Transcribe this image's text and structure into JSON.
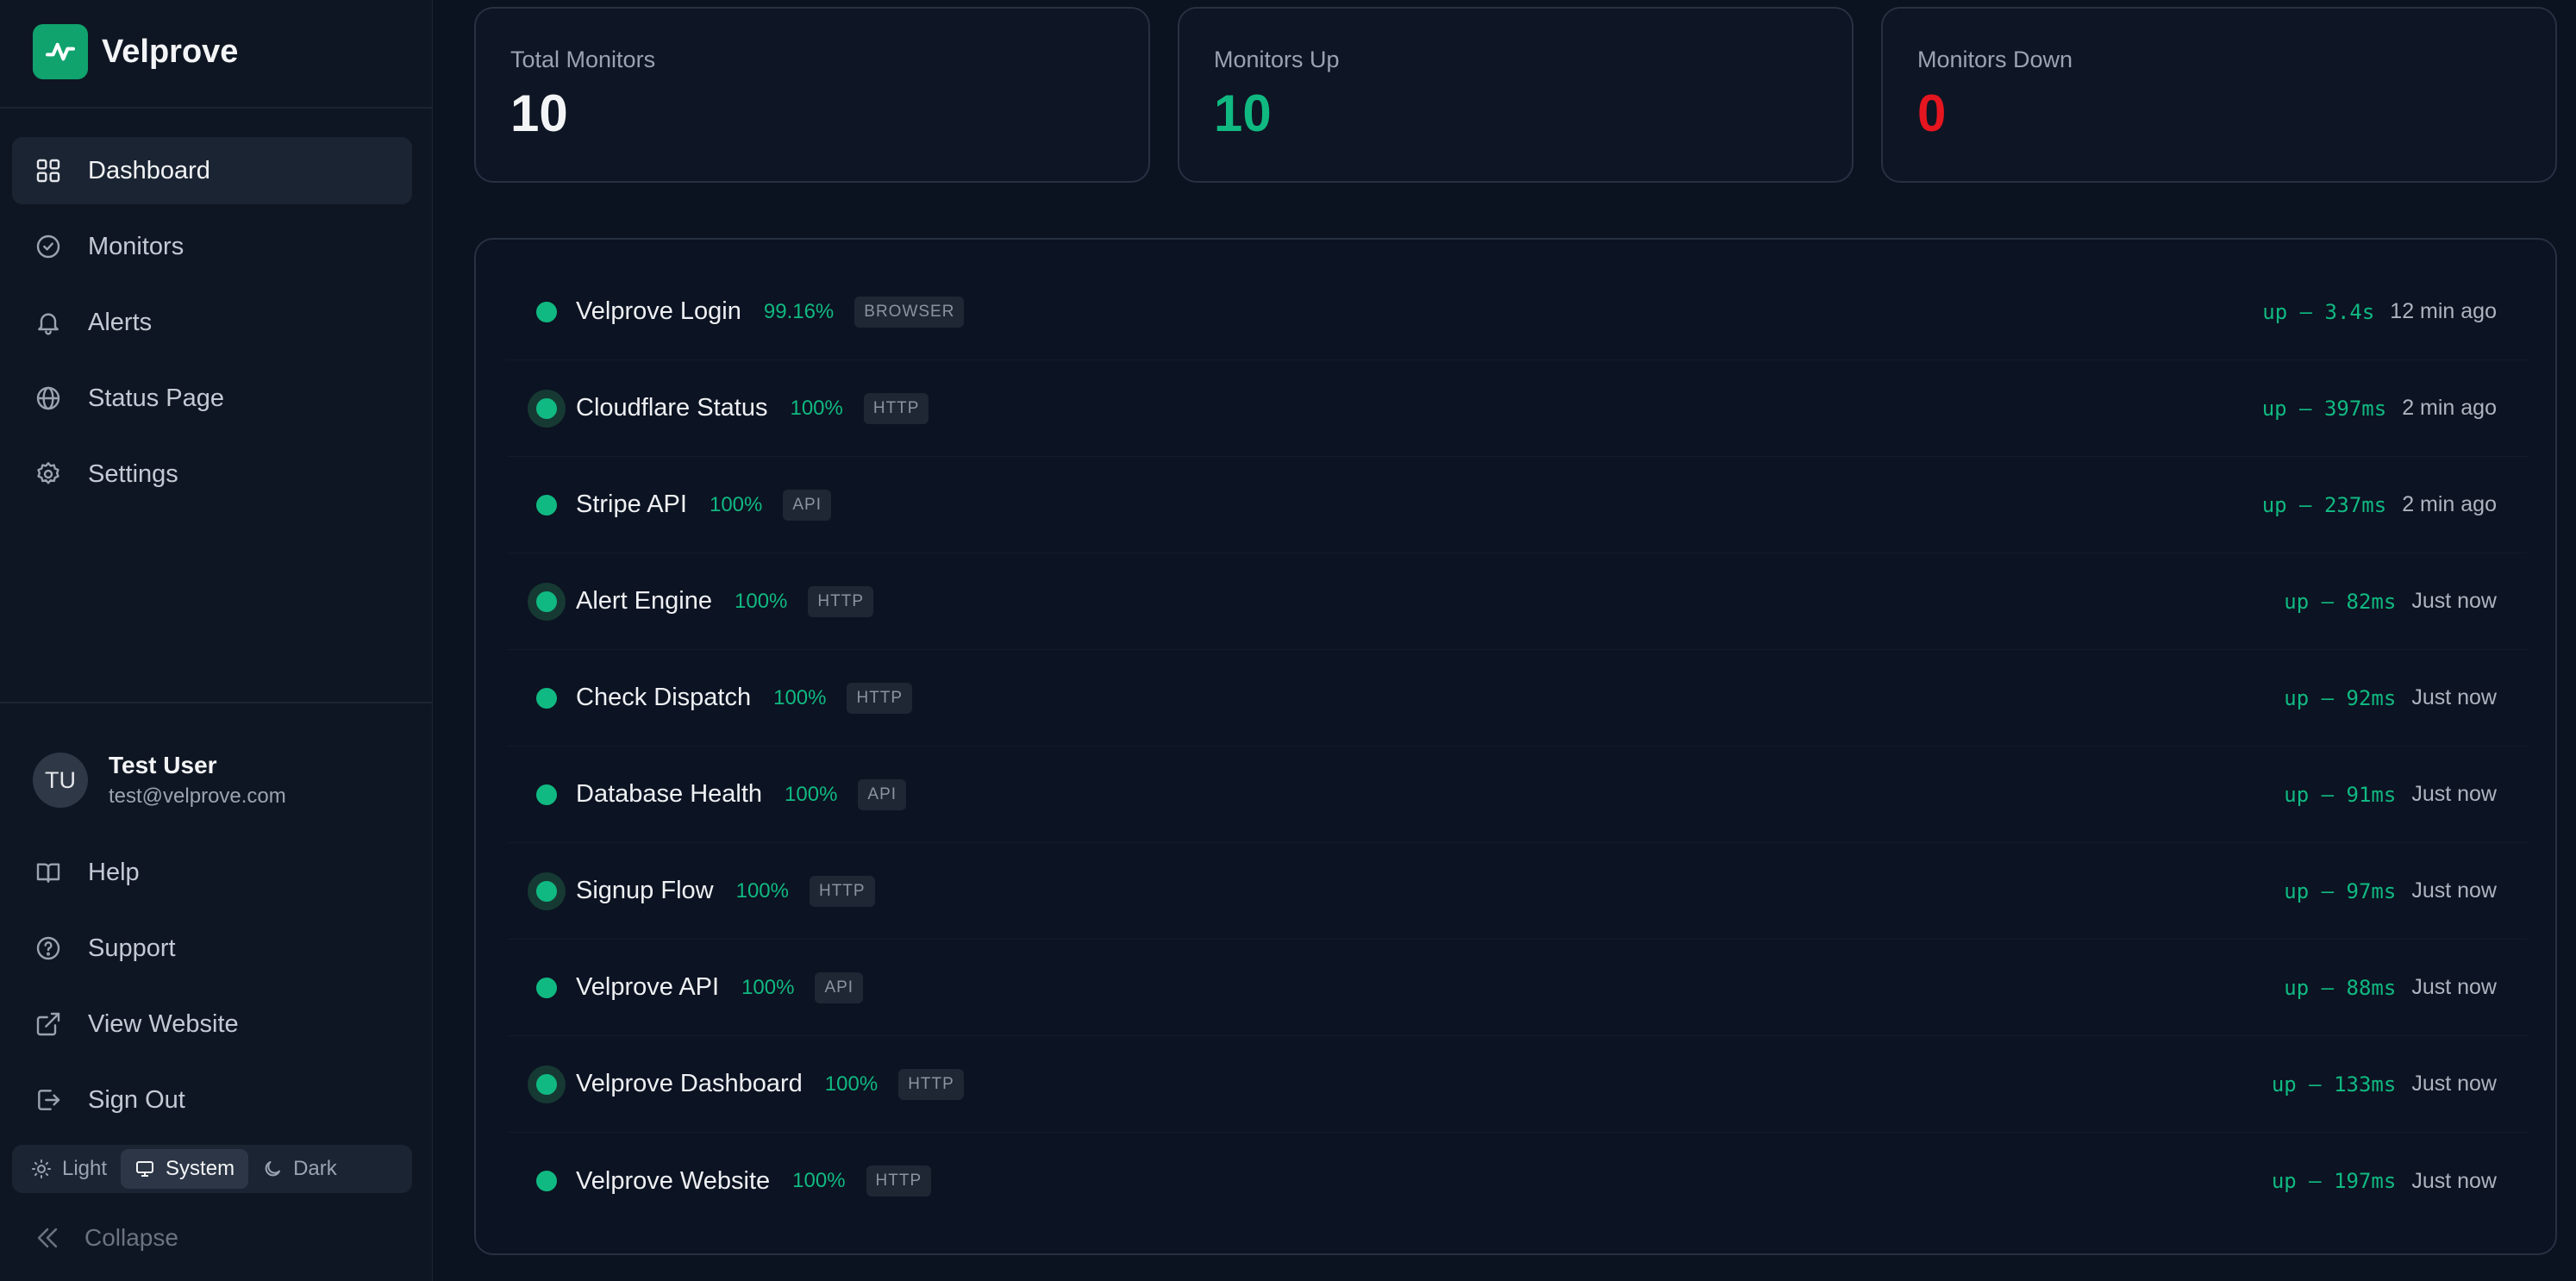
{
  "app": {
    "name": "Velprove",
    "brand_color": "#10a36e"
  },
  "sidebar": {
    "nav": [
      {
        "label": "Dashboard",
        "icon": "dashboard-grid-icon",
        "active": true
      },
      {
        "label": "Monitors",
        "icon": "check-circle-icon"
      },
      {
        "label": "Alerts",
        "icon": "bell-icon"
      },
      {
        "label": "Status Page",
        "icon": "globe-icon"
      },
      {
        "label": "Settings",
        "icon": "gear-icon"
      }
    ],
    "user": {
      "initials": "TU",
      "name": "Test User",
      "email": "test@velprove.com"
    },
    "footer_links": [
      {
        "label": "Help",
        "icon": "book-icon"
      },
      {
        "label": "Support",
        "icon": "help-circle-icon"
      },
      {
        "label": "View Website",
        "icon": "external-link-icon"
      },
      {
        "label": "Sign Out",
        "icon": "sign-out-icon"
      }
    ],
    "theme": {
      "options": [
        "Light",
        "System",
        "Dark"
      ],
      "selected": "System"
    },
    "collapse_label": "Collapse"
  },
  "stats": [
    {
      "label": "Total Monitors",
      "value": "10",
      "color": "#f3f4f6"
    },
    {
      "label": "Monitors Up",
      "value": "10",
      "color": "#10b981"
    },
    {
      "label": "Monitors Down",
      "value": "0",
      "color": "#e5161f"
    }
  ],
  "monitors": [
    {
      "name": "Velprove Login",
      "uptime": "99.16%",
      "type": "BROWSER",
      "status": "up – 3.4s",
      "time": "12 min ago",
      "halo": false
    },
    {
      "name": "Cloudflare Status",
      "uptime": "100%",
      "type": "HTTP",
      "status": "up – 397ms",
      "time": "2 min ago",
      "halo": true
    },
    {
      "name": "Stripe API",
      "uptime": "100%",
      "type": "API",
      "status": "up – 237ms",
      "time": "2 min ago",
      "halo": false
    },
    {
      "name": "Alert Engine",
      "uptime": "100%",
      "type": "HTTP",
      "status": "up – 82ms",
      "time": "Just now",
      "halo": true
    },
    {
      "name": "Check Dispatch",
      "uptime": "100%",
      "type": "HTTP",
      "status": "up – 92ms",
      "time": "Just now",
      "halo": false
    },
    {
      "name": "Database Health",
      "uptime": "100%",
      "type": "API",
      "status": "up – 91ms",
      "time": "Just now",
      "halo": false
    },
    {
      "name": "Signup Flow",
      "uptime": "100%",
      "type": "HTTP",
      "status": "up – 97ms",
      "time": "Just now",
      "halo": true
    },
    {
      "name": "Velprove API",
      "uptime": "100%",
      "type": "API",
      "status": "up – 88ms",
      "time": "Just now",
      "halo": false
    },
    {
      "name": "Velprove Dashboard",
      "uptime": "100%",
      "type": "HTTP",
      "status": "up – 133ms",
      "time": "Just now",
      "halo": true
    },
    {
      "name": "Velprove Website",
      "uptime": "100%",
      "type": "HTTP",
      "status": "up – 197ms",
      "time": "Just now",
      "halo": false
    }
  ]
}
